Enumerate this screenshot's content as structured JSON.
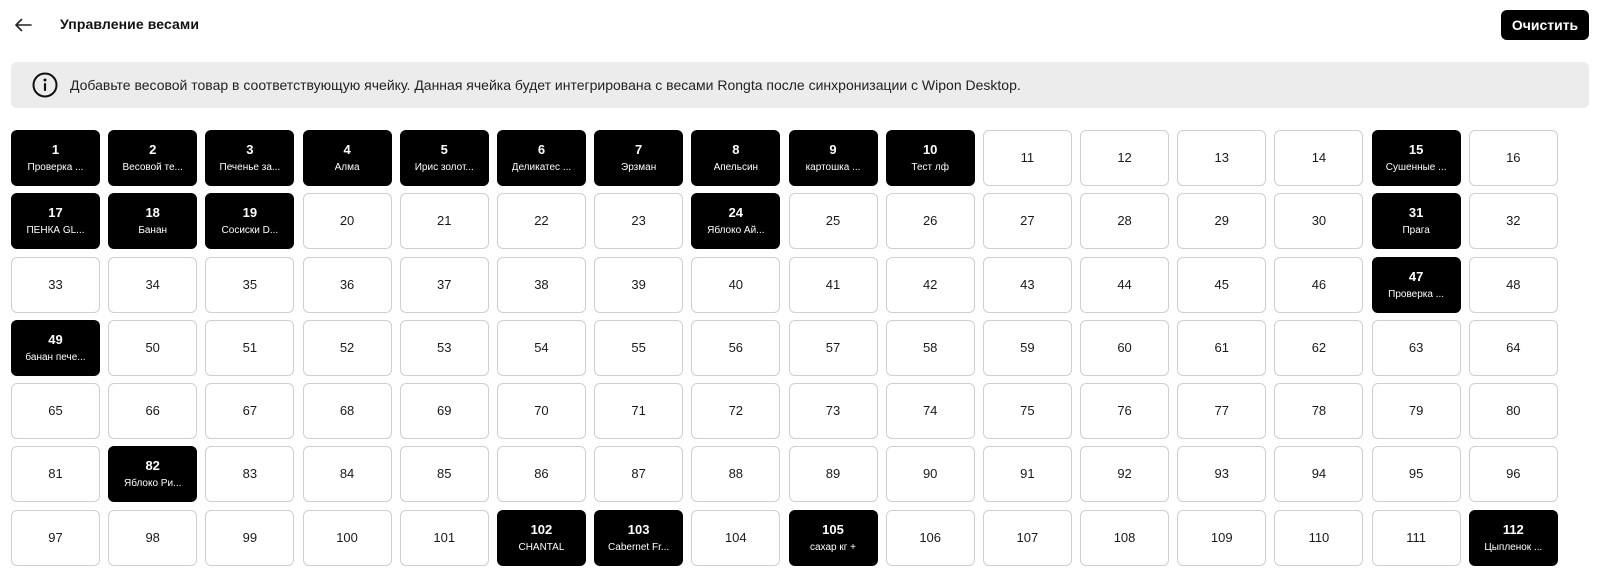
{
  "header": {
    "title": "Управление весами",
    "clear_label": "Очистить"
  },
  "info": {
    "text": "Добавьте весовой товар в соответствующую ячейку. Данная ячейка будет интегрирована с весами Rongta после синхронизации с Wipon Desktop."
  },
  "icons": {
    "back": "arrow-left-icon",
    "info": "info-circle-icon"
  },
  "colors": {
    "filled_cell": "#000000",
    "empty_cell_border": "#cfcfcf",
    "banner_bg": "#ececec"
  },
  "grid": {
    "columns": 16,
    "cells": [
      {
        "n": "1",
        "name": "Проверка ..."
      },
      {
        "n": "2",
        "name": "Весовой те..."
      },
      {
        "n": "3",
        "name": "Печенье за..."
      },
      {
        "n": "4",
        "name": "Алма"
      },
      {
        "n": "5",
        "name": "Ирис золот..."
      },
      {
        "n": "6",
        "name": "Деликатес ..."
      },
      {
        "n": "7",
        "name": "Эрзман"
      },
      {
        "n": "8",
        "name": "Апельсин"
      },
      {
        "n": "9",
        "name": "картошка ..."
      },
      {
        "n": "10",
        "name": "Тест лф"
      },
      {
        "n": "11"
      },
      {
        "n": "12"
      },
      {
        "n": "13"
      },
      {
        "n": "14"
      },
      {
        "n": "15",
        "name": "Сушенные ..."
      },
      {
        "n": "16"
      },
      {
        "n": "17",
        "name": "ПЕНКА GL..."
      },
      {
        "n": "18",
        "name": "Банан"
      },
      {
        "n": "19",
        "name": "Сосиски D..."
      },
      {
        "n": "20"
      },
      {
        "n": "21"
      },
      {
        "n": "22"
      },
      {
        "n": "23"
      },
      {
        "n": "24",
        "name": "Яблоко Ай..."
      },
      {
        "n": "25"
      },
      {
        "n": "26"
      },
      {
        "n": "27"
      },
      {
        "n": "28"
      },
      {
        "n": "29"
      },
      {
        "n": "30"
      },
      {
        "n": "31",
        "name": "Прага"
      },
      {
        "n": "32"
      },
      {
        "n": "33"
      },
      {
        "n": "34"
      },
      {
        "n": "35"
      },
      {
        "n": "36"
      },
      {
        "n": "37"
      },
      {
        "n": "38"
      },
      {
        "n": "39"
      },
      {
        "n": "40"
      },
      {
        "n": "41"
      },
      {
        "n": "42"
      },
      {
        "n": "43"
      },
      {
        "n": "44"
      },
      {
        "n": "45"
      },
      {
        "n": "46"
      },
      {
        "n": "47",
        "name": "Проверка ..."
      },
      {
        "n": "48"
      },
      {
        "n": "49",
        "name": "банан пече..."
      },
      {
        "n": "50"
      },
      {
        "n": "51"
      },
      {
        "n": "52"
      },
      {
        "n": "53"
      },
      {
        "n": "54"
      },
      {
        "n": "55"
      },
      {
        "n": "56"
      },
      {
        "n": "57"
      },
      {
        "n": "58"
      },
      {
        "n": "59"
      },
      {
        "n": "60"
      },
      {
        "n": "61"
      },
      {
        "n": "62"
      },
      {
        "n": "63"
      },
      {
        "n": "64"
      },
      {
        "n": "65"
      },
      {
        "n": "66"
      },
      {
        "n": "67"
      },
      {
        "n": "68"
      },
      {
        "n": "69"
      },
      {
        "n": "70"
      },
      {
        "n": "71"
      },
      {
        "n": "72"
      },
      {
        "n": "73"
      },
      {
        "n": "74"
      },
      {
        "n": "75"
      },
      {
        "n": "76"
      },
      {
        "n": "77"
      },
      {
        "n": "78"
      },
      {
        "n": "79"
      },
      {
        "n": "80"
      },
      {
        "n": "81"
      },
      {
        "n": "82",
        "name": "Яблоко Ри..."
      },
      {
        "n": "83"
      },
      {
        "n": "84"
      },
      {
        "n": "85"
      },
      {
        "n": "86"
      },
      {
        "n": "87"
      },
      {
        "n": "88"
      },
      {
        "n": "89"
      },
      {
        "n": "90"
      },
      {
        "n": "91"
      },
      {
        "n": "92"
      },
      {
        "n": "93"
      },
      {
        "n": "94"
      },
      {
        "n": "95"
      },
      {
        "n": "96"
      },
      {
        "n": "97"
      },
      {
        "n": "98"
      },
      {
        "n": "99"
      },
      {
        "n": "100"
      },
      {
        "n": "101"
      },
      {
        "n": "102",
        "name": "CHANTAL"
      },
      {
        "n": "103",
        "name": "Cabernet Fr..."
      },
      {
        "n": "104"
      },
      {
        "n": "105",
        "name": "сахар кг +"
      },
      {
        "n": "106"
      },
      {
        "n": "107"
      },
      {
        "n": "108"
      },
      {
        "n": "109"
      },
      {
        "n": "110"
      },
      {
        "n": "111"
      },
      {
        "n": "112",
        "name": "Цыпленок ..."
      }
    ]
  }
}
